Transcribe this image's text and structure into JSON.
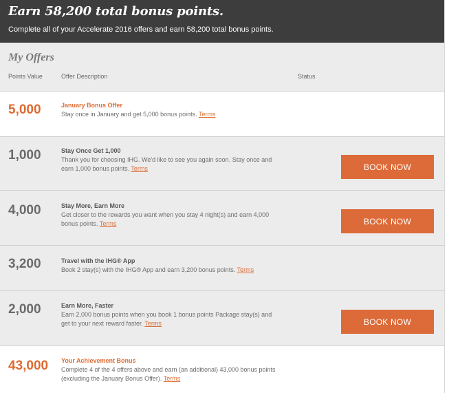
{
  "banner": {
    "title": "Earn 58,200 total bonus points.",
    "subtitle": "Complete all of your Accelerate 2016 offers and earn 58,200 total bonus points."
  },
  "offers": {
    "heading": "My Offers",
    "columns": {
      "points": "Points Value",
      "description": "Offer Description",
      "status": "Status"
    },
    "terms_label": "Terms",
    "book_label": "BOOK NOW",
    "rows": [
      {
        "points": "5,000",
        "title": "January Bonus Offer",
        "text": "Stay once in January and get 5,000 bonus points."
      },
      {
        "points": "1,000",
        "title": "Stay Once Get 1,000",
        "text": "Thank you for choosing IHG. We'd like to see you again soon. Stay once and earn 1,000 bonus points."
      },
      {
        "points": "4,000",
        "title": "Stay More, Earn More",
        "text": "Get closer to the rewards you want when you stay 4 night(s) and earn 4,000 bonus points."
      },
      {
        "points": "3,200",
        "title": "Travel with the IHG® App",
        "text": "Book 2 stay(s) with the IHG® App and earn 3,200 bonus points."
      },
      {
        "points": "2,000",
        "title": "Earn More, Faster",
        "text": "Earn 2,000 bonus points when you book 1 bonus points Package stay(s) and get to your next reward faster."
      },
      {
        "points": "43,000",
        "title": "Your Achievement Bonus",
        "text": "Complete 4 of the 4 offers above and earn (an additional) 43,000 bonus points (excluding the January Bonus Offer)."
      }
    ]
  },
  "colors": {
    "accent": "#dd6b32",
    "banner_bg": "#3d3d3d",
    "row_grey": "#ececec"
  }
}
